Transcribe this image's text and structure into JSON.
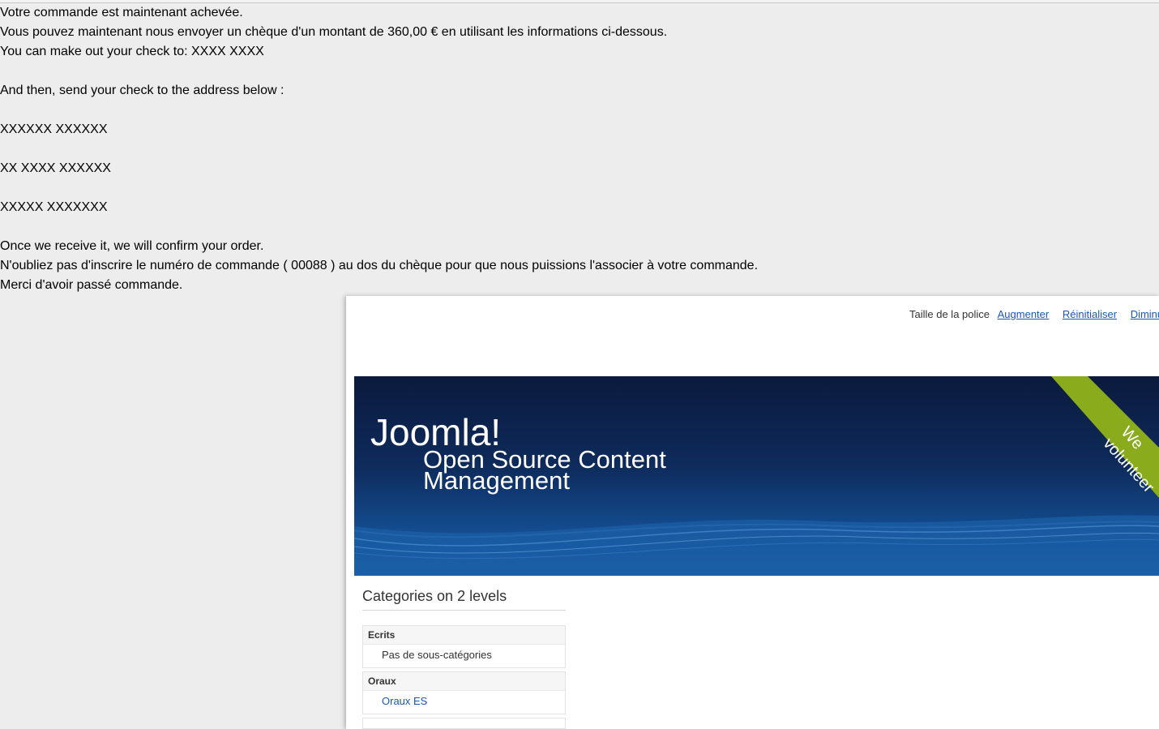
{
  "order_message": {
    "line1": "Votre commande est maintenant achevée.",
    "line2": "Vous pouvez maintenant nous envoyer un chèque d'un montant de 360,00 € en utilisant les informations ci-dessous.",
    "line3": "You can make out your check to: XXXX XXXX",
    "line4": "And then, send your check to the address below :",
    "address1": "XXXXXX XXXXXX",
    "address2": "XX XXXX XXXXXX",
    "address3": "XXXXX XXXXXXX",
    "line5": "Once we receive it, we will confirm your order.",
    "line6": "N'oubliez pas d'inscrire le numéro de commande ( 00088 ) au dos du chèque pour que nous puissions l'associer à votre commande.",
    "line7": "Merci d'avoir passé commande."
  },
  "font_size_controls": {
    "label": "Taille de la police",
    "increase": "Augmenter",
    "reset": "Réinitialiser",
    "decrease": "Diminu"
  },
  "header": {
    "title": "Joomla!",
    "subtitle": "Open Source Content Management",
    "ribbon": "We\nvolunteer"
  },
  "categories_module": {
    "title": "Categories on 2 levels",
    "categories": [
      {
        "name": "Ecrits",
        "sub": "Pas de sous-catégories",
        "sub_is_link": false
      },
      {
        "name": "Oraux",
        "sub": "Oraux ES",
        "sub_is_link": true
      }
    ]
  },
  "colors": {
    "page_background": "#ededed",
    "link": "#1b57b1",
    "ribbon": "#8aab1c",
    "header_dark": "#0b1a3d"
  }
}
